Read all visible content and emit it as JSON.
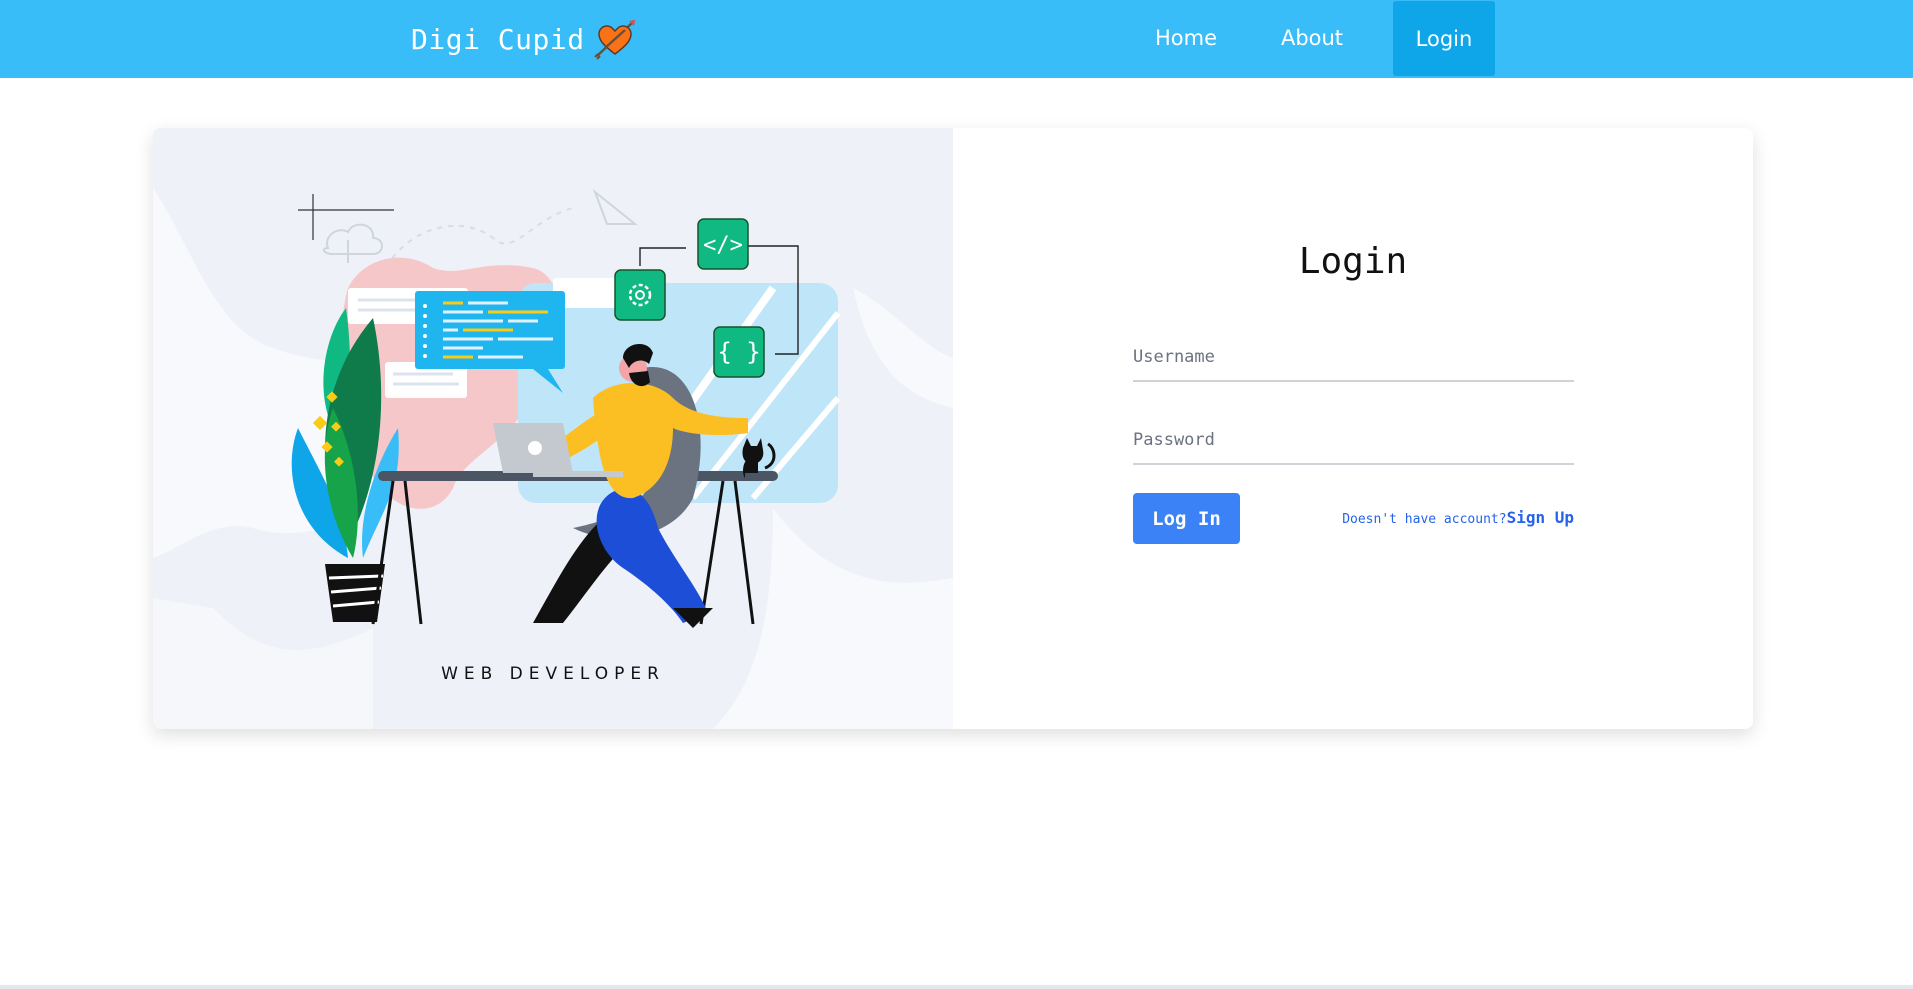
{
  "navbar": {
    "brand": "Digi Cupid",
    "brand_icon": "heart-arrow-icon",
    "links": {
      "home": "Home",
      "about": "About",
      "login": "Login"
    },
    "color": "#38bdf8",
    "active_color": "#0ea5e9"
  },
  "illustration": {
    "caption": "WEB DEVELOPER"
  },
  "login_form": {
    "title": "Login",
    "username_placeholder": "Username",
    "password_placeholder": "Password",
    "submit_label": "Log In",
    "signup_hint": "Doesn't have account?",
    "signup_link": "Sign Up",
    "button_color": "#3b82f6"
  }
}
